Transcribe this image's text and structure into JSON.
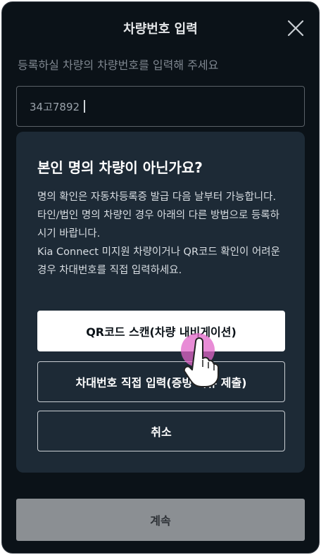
{
  "header": {
    "title": "차량번호 입력",
    "close_icon": "close-icon"
  },
  "subtitle": "등록하실 차량의 차량번호를 입력해 주세요",
  "plate_input": {
    "value": "34고7892"
  },
  "dialog": {
    "title": "본인 명의 차량이 아닌가요?",
    "body_1": "명의 확인은 자동차등록증 발급 다음 날부터 가능합니다. 타인/법인 명의 차량인 경우 아래의 다른 방법으로 등록하시기 바랍니다.",
    "body_2": "Kia Connect 미지원 차량이거나 QR코드 확인이 어려운 경우 차대번호를 직접 입력하세요.",
    "buttons": {
      "qr_scan": "QR코드 스캔(차량 내비게이션)",
      "manual_entry": "차대번호 직접 입력(증빙 서류 제출)",
      "cancel": "취소"
    }
  },
  "footer": {
    "continue_label": "계속"
  },
  "colors": {
    "background": "#0b1218",
    "dialog": "#1d2a36",
    "primary_button": "#ffffff",
    "disabled_button": "#8b8f93",
    "tap_highlight": "#e066c8"
  },
  "icons": [
    "close-icon",
    "tap-hand-icon"
  ]
}
